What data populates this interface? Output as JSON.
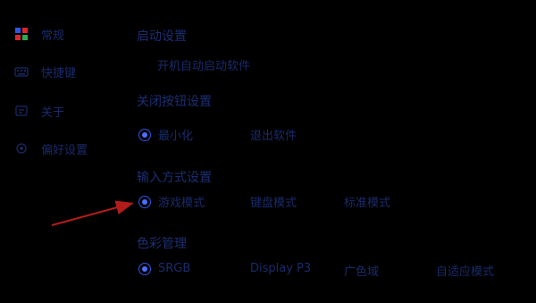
{
  "sidebar": {
    "items": [
      {
        "label": "常规",
        "icon": "grid-icon"
      },
      {
        "label": "快捷键",
        "icon": "keyboard-icon"
      },
      {
        "label": "关于",
        "icon": "info-icon"
      },
      {
        "label": "偏好设置",
        "icon": "settings-icon"
      }
    ]
  },
  "sections": {
    "startup": {
      "title": "启动设置",
      "option": "开机自动启动软件"
    },
    "close_button": {
      "title": "关闭按钮设置",
      "options": [
        "最小化",
        "退出软件"
      ],
      "selected": "最小化"
    },
    "input_method": {
      "title": "输入方式设置",
      "options": [
        "游戏模式",
        "键盘模式",
        "标准模式"
      ],
      "selected": "游戏模式"
    },
    "color_management": {
      "title": "色彩管理",
      "options": [
        "SRGB",
        "Display P3",
        "广色域",
        "自适应模式"
      ],
      "selected": "SRGB"
    }
  },
  "colors": {
    "background": "#000000",
    "text": "#1a2a6a",
    "radio_accent": "#4a70ff",
    "annotation_arrow": "#b41c1c"
  }
}
